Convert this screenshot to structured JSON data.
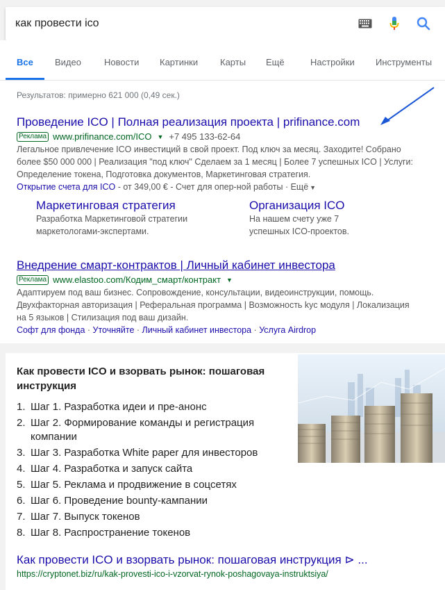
{
  "search": {
    "query": "как провести ico"
  },
  "tabs": [
    {
      "label": "Все",
      "active": true
    },
    {
      "label": "Видео"
    },
    {
      "label": "Новости"
    },
    {
      "label": "Картинки"
    },
    {
      "label": "Карты"
    },
    {
      "label": "Ещё"
    },
    {
      "label": "Настройки"
    },
    {
      "label": "Инструменты"
    }
  ],
  "stats": "Результатов: примерно 621 000 (0,49 сек.)",
  "ad1": {
    "title": "Проведение ICO | Полная реализация проекта | prifinance.com",
    "badge": "Реклама",
    "url": "www.prifinance.com/ICO",
    "phone": "+7 495 133-62-64",
    "desc": [
      "Легальное привлечение ICO инвестиций в свой проект. Под ключ за месяц. Заходите! Собрано",
      "более $50 000 000 | Реализация \"под ключ\" Сделаем за 1 месяц | Более 7 успешных ICO | Услуги:",
      "Определение токена, Подготовка документов, Маркетинговая стратегия."
    ],
    "extra_link": "Открытие счета для ICO",
    "extra_price": " - от 349,00 € - Счет для опер-ной работы · ",
    "extra_more": "Ещё",
    "sitelinks": [
      {
        "title": "Маркетинговая стратегия",
        "desc1": "Разработка Маркетинговой стратегии",
        "desc2": "маркетологами-экспертами."
      },
      {
        "title": "Организация ICO",
        "desc1": "На нашем счету уже 7",
        "desc2": "успешных ICO-проектов."
      }
    ]
  },
  "ad2": {
    "title": "Внедрение смарт-контрактов | Личный кабинет инвестора",
    "badge": "Реклама",
    "url": "www.elastoo.com/Кодим_смарт/контракт",
    "desc": [
      "Адаптируем под ваш бизнес. Сопровождение, консультации, видеоинструкции, помощь.",
      "Двухфакторная авторизация | Реферальная программа | Возможность kyc модуля | Локализация",
      "на 5 языков | Стилизация под ваш дизайн."
    ],
    "links": [
      "Софт для фонда",
      "Уточняйте",
      "Личный кабинет инвестора",
      "Услуга Airdrop"
    ]
  },
  "snippet": {
    "title": "Как провести ICO и взорвать рынок: пошаговая инструкция",
    "steps": [
      "Шаг 1. Разработка идеи и пре-анонс",
      "Шаг 2. Формирование команды и регистрация компании",
      "Шаг 3. Разработка White paper для инвесторов",
      "Шаг 4. Разработка и запуск сайта",
      "Шаг 5. Реклама и продвижение в соцсетях",
      "Шаг 6. Проведение bounty-кампании",
      "Шаг 7. Выпуск токенов",
      "Шаг 8. Распространение токенов"
    ],
    "link": "Как провести ICO и взорвать рынок: пошаговая инструкция ⊳ ...",
    "url": "https://cryptonet.biz/ru/kak-provesti-ico-i-vzorvat-rynok-poshagovaya-instruktsiya/"
  },
  "icons": [
    "keyboard-icon",
    "microphone-icon",
    "search-icon",
    "caret-down-icon"
  ],
  "colors": {
    "link": "#1a0dab",
    "url": "#006621",
    "accent": "#1a73e8",
    "annotation_arrow": "#1a56d6"
  }
}
